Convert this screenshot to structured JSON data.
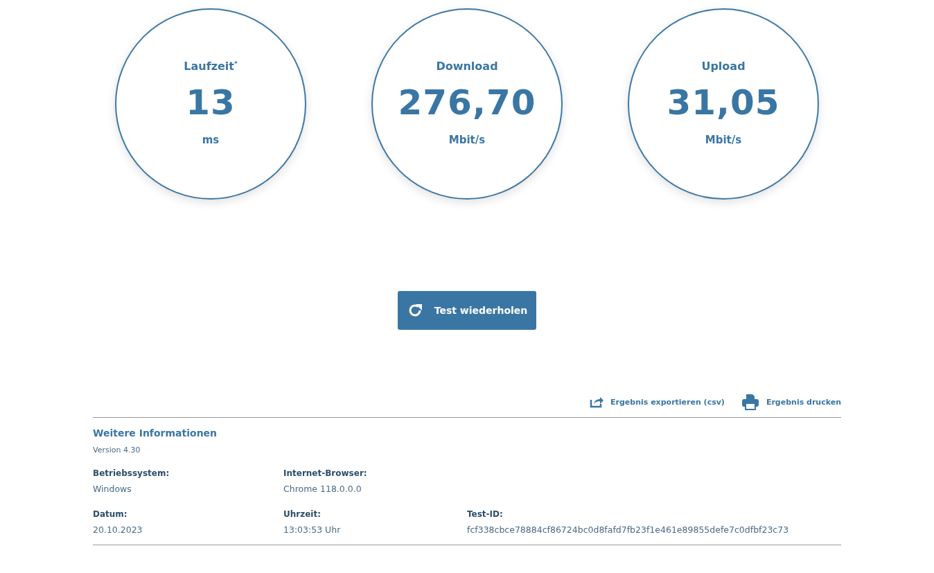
{
  "metrics": [
    {
      "label": "Laufzeit$^{*}$",
      "value": "13",
      "unit": "ms"
    },
    {
      "label": "Download",
      "value": "276,70",
      "unit": "Mbit/s"
    },
    {
      "label": "Upload",
      "value": "31,05",
      "unit": "Mbit/s"
    }
  ],
  "repeat_button": {
    "label": "Test wiederholen"
  },
  "actions": [
    {
      "kind": "export",
      "label": "Ergebnis exportieren (csv)"
    },
    {
      "kind": "print",
      "label": "Ergebnis drucken"
    }
  ],
  "info": {
    "title": "Weitere Informationen",
    "version": "Version 4.30",
    "rows": [
      [
        {
          "label": "Betriebssystem:",
          "value": "Windows"
        },
        {
          "label": "Internet-Browser:",
          "value": "Chrome 118.0.0.0"
        }
      ],
      [
        {
          "label": "Datum:",
          "value": "20.10.2023"
        },
        {
          "label": "Uhrzeit:",
          "value": "13:03:53 Uhr"
        },
        {
          "label": "Test-ID:",
          "value": "fcf338cbce78884cf86724bc0d8fafd7fb23f1e461e89855defe7c0dfbf23c73"
        }
      ]
    ]
  }
}
